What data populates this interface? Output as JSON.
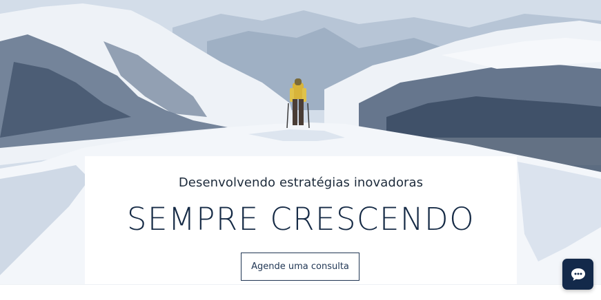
{
  "hero": {
    "image": "snowy mountain summit with hiker",
    "subtitle": "Desenvolvendo estratégias inovadoras",
    "headline": "SEMPRE CRESCENDO",
    "cta_label": "Agende uma consulta"
  },
  "chat": {
    "icon": "chat-bubble-icon"
  },
  "colors": {
    "brand": "#13294a",
    "text": "#152a45"
  }
}
